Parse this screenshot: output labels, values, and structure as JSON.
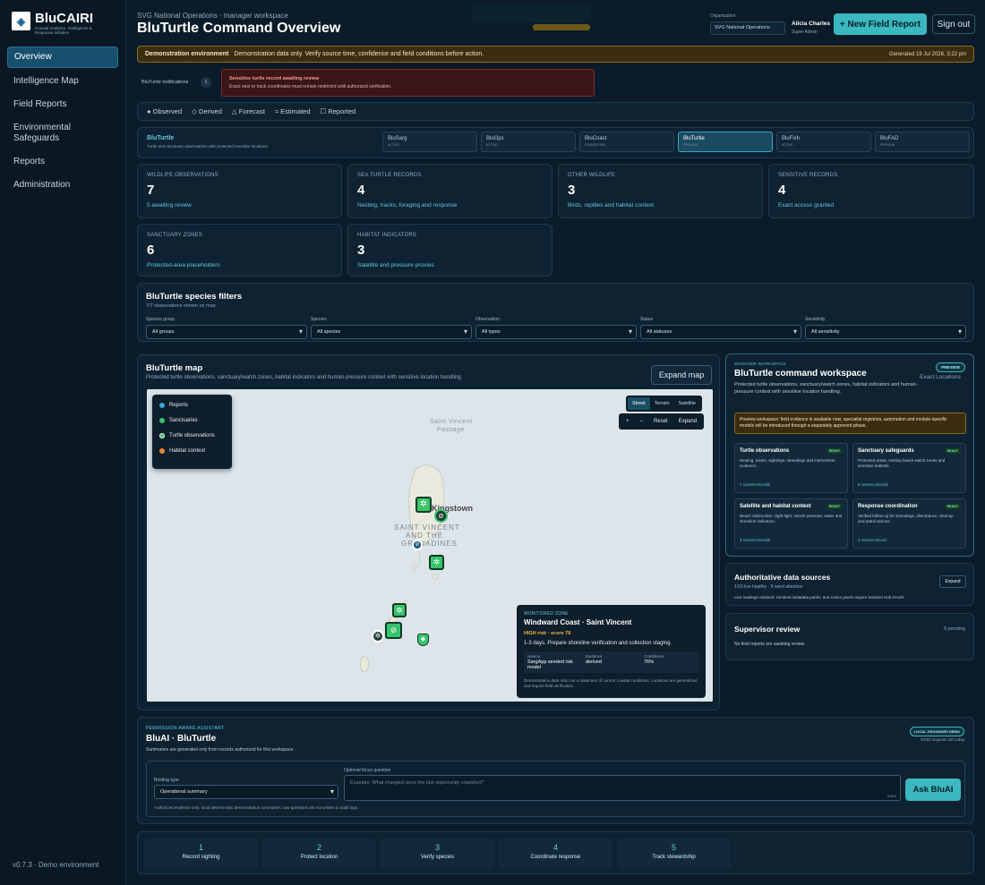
{
  "brand": {
    "name": "BluCAIRI",
    "tagline": "Coastal Analytics, Intelligence & Response Initiative",
    "version": "v0.7.3 · Demo environment"
  },
  "nav": [
    {
      "label": "Overview",
      "active": true
    },
    {
      "label": "Intelligence Map"
    },
    {
      "label": "Field Reports"
    },
    {
      "label": "Environmental Safeguards"
    },
    {
      "label": "Reports"
    },
    {
      "label": "Administration"
    }
  ],
  "header": {
    "breadcrumb": "SVG National Operations · manager workspace",
    "title": "BluTurtle Command Overview",
    "org_label": "Organization",
    "org_value": "SVG National Operations",
    "user_name": "Alicia Charles",
    "user_role": "Super Admin",
    "new_report": "+ New Field Report",
    "sign_out": "Sign out"
  },
  "banner": {
    "label": "Demonstration environment",
    "text": "Demonstration data only. Verify source time, confidence and field conditions before action.",
    "generated": "Generated 19 Jul 2026, 3:22 pm"
  },
  "notifications": {
    "label": "BluTurtle notifications",
    "count": "1",
    "alert_title": "Sensitive turtle record awaiting review",
    "alert_text": "Exact nest or track coordinates must remain restricted until authorized verification."
  },
  "legend_bar": [
    "Observed",
    "Derived",
    "Forecast",
    "Estimated",
    "Reported"
  ],
  "module": {
    "name": "BluTurtle",
    "desc": "Turtle and sanctuary observations with protected sensitive locations.",
    "tabs": [
      {
        "name": "BluSarg",
        "status": "ACTIVE"
      },
      {
        "name": "BluOps",
        "status": "ACTIVE"
      },
      {
        "name": "BluCoast",
        "status": "FOUNDATION"
      },
      {
        "name": "BluTurtle",
        "status": "PREVIEW",
        "active": true
      },
      {
        "name": "BluFish",
        "status": "ACTIVE"
      },
      {
        "name": "BluFAD",
        "status": "PREVIEW"
      }
    ]
  },
  "stats": [
    {
      "label": "WILDLIFE OBSERVATIONS",
      "value": "7",
      "desc": "5 awaiting review"
    },
    {
      "label": "SEA TURTLE RECORDS",
      "value": "4",
      "desc": "Nesting, tracks, foraging and response"
    },
    {
      "label": "OTHER WILDLIFE",
      "value": "3",
      "desc": "Birds, reptiles and habitat context"
    },
    {
      "label": "SENSITIVE RECORDS",
      "value": "4",
      "desc": "Exact access granted"
    },
    {
      "label": "SANCTUARY ZONES",
      "value": "6",
      "desc": "Protected-area placeholders"
    },
    {
      "label": "HABITAT INDICATORS",
      "value": "3",
      "desc": "Satellite and pressure proxies"
    }
  ],
  "filters": {
    "title": "BluTurtle species filters",
    "subtitle": "7/7 observations shown on map",
    "groups": [
      {
        "label": "Species group",
        "value": "All groups"
      },
      {
        "label": "Species",
        "value": "All species"
      },
      {
        "label": "Observation",
        "value": "All types"
      },
      {
        "label": "Status",
        "value": "All statuses"
      },
      {
        "label": "Sensitivity",
        "value": "All sensitivity"
      }
    ]
  },
  "map": {
    "title": "BluTurtle map",
    "subtitle": "Protected turtle observations, sanctuary/watch zones, habitat indicators and human-pressure context with sensitive location handling.",
    "expand": "Expand map",
    "legend": [
      {
        "label": "Reports",
        "color": "#2fa8d8"
      },
      {
        "label": "Sanctuaries",
        "color": "#37c46b"
      },
      {
        "label": "Turtle observations",
        "color": "#37c46b"
      },
      {
        "label": "Habitat context",
        "color": "#e8822f"
      }
    ],
    "styles": [
      "Street",
      "Terrain",
      "Satellite"
    ],
    "controls": [
      "+",
      "−",
      "Reset",
      "Expand"
    ],
    "place_labels": [
      "Saint Vincent",
      "Passage",
      "Kingstown",
      "SAINT VINCENT",
      "AND THE",
      "GRENADINES"
    ],
    "popup": {
      "kicker": "MONITORED ZONE",
      "title": "Windward Coast · Saint Vincent",
      "risk": "HIGH risk · score 78",
      "detail": "1-3 days. Prepare shoreline verification and collection staging.",
      "cells": [
        {
          "label": "Source",
          "value": "SargApp seeded risk model"
        },
        {
          "label": "Evidence",
          "value": "derived"
        },
        {
          "label": "Confidence",
          "value": "76%"
        }
      ],
      "note": "Demonstration data only; not a statement of current coastal conditions. Locations are generalized and require field verification."
    }
  },
  "workspace": {
    "kicker": "MANAGER WORKSPACE",
    "title": "BluTurtle command workspace",
    "desc": "Protected turtle observations, sanctuary/watch zones, habitat indicators and human-pressure context with sensitive location handling.",
    "badge": "PREVIEW",
    "exact": "Exact Locations",
    "warning": "Preview workspace: field evidence is available now; specialist registries, automation and module-specific models will be introduced through a separately approved phase.",
    "cards": [
      {
        "title": "Turtle observations",
        "badge": "READY",
        "desc": "Nesting, tracks, sightings, strandings and intervention evidence.",
        "count": "7 current records"
      },
      {
        "title": "Sanctuary safeguards",
        "badge": "READY",
        "desc": "Protected areas, nesting beach watch zones and sensitive habitats.",
        "count": "6 current records"
      },
      {
        "title": "Satellite and habitat context",
        "badge": "READY",
        "desc": "Beach obstruction, night-light, vessel pressure, water and shoreline indicators.",
        "count": "3 current records"
      },
      {
        "title": "Response coordination",
        "badge": "READY",
        "desc": "Verified follow-up for strandings, disturbance, cleanup and patrol actions.",
        "count": "1 current record"
      }
    ]
  },
  "sources": {
    "title": "Authoritative data sources",
    "status": "1/10 live healthy · 9 need attention",
    "note": "Live readings retained. Sentinel metadata public; true-colour pixels require Sentinel Hub OAuth.",
    "expand": "Expand"
  },
  "supervisor": {
    "title": "Supervisor review",
    "pending": "0 pending",
    "empty": "No field reports are awaiting review."
  },
  "assistant": {
    "kicker": "PERMISSION-AWARE ASSISTANT",
    "title": "BluAI · BluTurtle",
    "desc": "Summaries are generated only from records authorized for this workspace.",
    "badge": "LOCAL GROUNDED DEMO",
    "quota": "30/30 requests left today",
    "briefing_label": "Briefing type",
    "briefing_value": "Operational summary",
    "question_label": "Optional focus question",
    "question_placeholder": "Example: What changed since the last opportunity snapshot?",
    "counter": "0/320",
    "ask": "Ask BluAI",
    "note": "Authorized evidence only; local deterministic demonstration summaries; raw questions are not written to audit logs."
  },
  "steps": [
    {
      "n": "1",
      "label": "Record sighting"
    },
    {
      "n": "2",
      "label": "Protect location"
    },
    {
      "n": "3",
      "label": "Verify species"
    },
    {
      "n": "4",
      "label": "Coordinate response"
    },
    {
      "n": "5",
      "label": "Track stewardship"
    }
  ]
}
